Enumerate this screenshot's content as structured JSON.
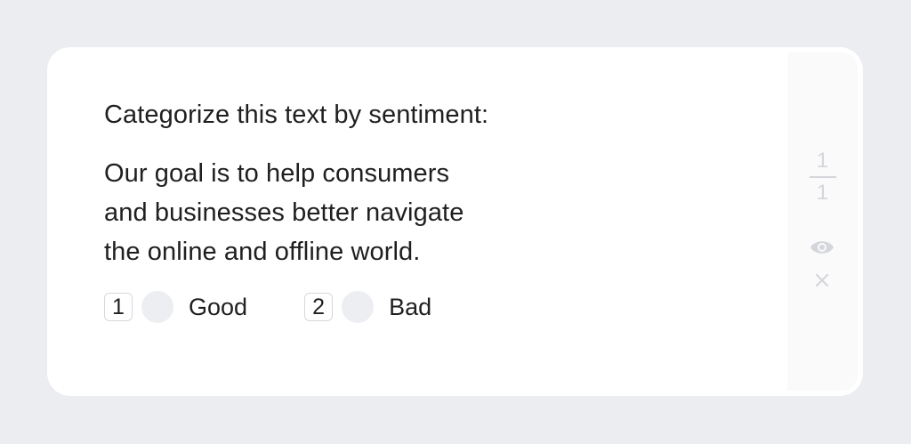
{
  "task": {
    "prompt": "Categorize this text by sentiment:",
    "sample_lines": [
      "Our goal is to help consumers",
      "and businesses better navigate",
      "the online and offline world."
    ],
    "options": [
      {
        "key": "1",
        "label": "Good"
      },
      {
        "key": "2",
        "label": "Bad"
      }
    ]
  },
  "side_panel": {
    "counter_numerator": "1",
    "counter_denominator": "1",
    "icons": [
      "eye-icon",
      "close-icon"
    ]
  },
  "colors": {
    "background": "#ecedf1",
    "card": "#ffffff",
    "side_panel": "#fafafb",
    "muted": "#d4d6db",
    "radio": "#eceef2"
  }
}
